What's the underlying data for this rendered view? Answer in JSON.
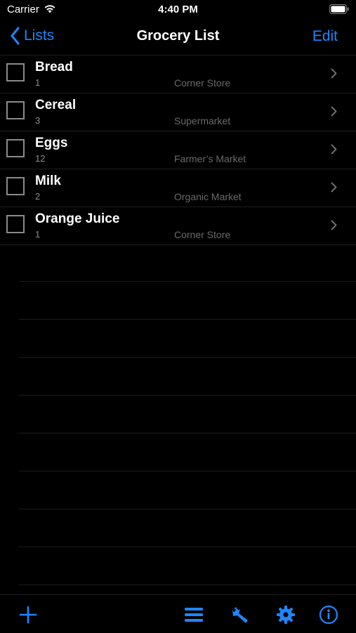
{
  "status_bar": {
    "carrier": "Carrier",
    "time": "4:40 PM"
  },
  "nav": {
    "back_label": "Lists",
    "title": "Grocery List",
    "edit_label": "Edit"
  },
  "items": [
    {
      "name": "Bread",
      "qty": "1",
      "store": "Corner Store",
      "checked": false
    },
    {
      "name": "Cereal",
      "qty": "3",
      "store": "Supermarket",
      "checked": false
    },
    {
      "name": "Eggs",
      "qty": "12",
      "store": "Farmer’s Market",
      "checked": false
    },
    {
      "name": "Milk",
      "qty": "2",
      "store": "Organic Market",
      "checked": false
    },
    {
      "name": "Orange Juice",
      "qty": "1",
      "store": "Corner Store",
      "checked": false
    }
  ],
  "toolbar": {
    "buttons": [
      "add-icon",
      "list-icon",
      "wrench-icon",
      "gear-icon",
      "info-icon"
    ]
  },
  "colors": {
    "accent": "#1e86ff",
    "background": "#000000",
    "separator": "#1f1f1f",
    "secondary_text": "#8e8e8e",
    "store_text": "#6a6a6a"
  }
}
